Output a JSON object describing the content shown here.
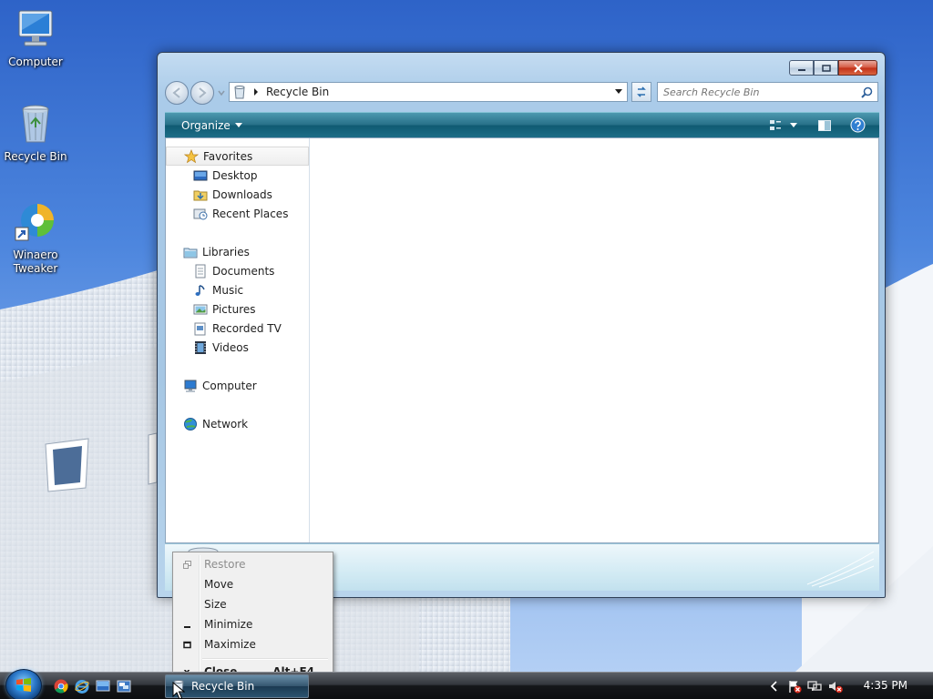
{
  "desktop": {
    "icons": [
      {
        "label": "Computer",
        "icon": "computer-icon"
      },
      {
        "label": "Recycle Bin",
        "icon": "recycle-bin-icon"
      },
      {
        "label": "Winaero Tweaker",
        "icon": "winaero-tweaker-icon"
      }
    ]
  },
  "window": {
    "address": {
      "crumb": "Recycle Bin"
    },
    "search": {
      "placeholder": "Search Recycle Bin"
    },
    "toolbar": {
      "organize_label": "Organize"
    },
    "nav_pane": {
      "favorites": {
        "label": "Favorites",
        "items": [
          "Desktop",
          "Downloads",
          "Recent Places"
        ]
      },
      "libraries": {
        "label": "Libraries",
        "items": [
          "Documents",
          "Music",
          "Pictures",
          "Recorded TV",
          "Videos"
        ]
      },
      "computer": "Computer",
      "network": "Network"
    }
  },
  "context_menu": {
    "items": [
      {
        "label": "Restore",
        "shortcut": "",
        "disabled": true
      },
      {
        "label": "Move",
        "shortcut": ""
      },
      {
        "label": "Size",
        "shortcut": ""
      },
      {
        "label": "Minimize",
        "shortcut": ""
      },
      {
        "label": "Maximize",
        "shortcut": ""
      },
      {
        "label": "Close",
        "shortcut": "Alt+F4",
        "icon_glyph": "x"
      }
    ]
  },
  "taskbar": {
    "active_task": "Recycle Bin",
    "clock": "4:35 PM"
  },
  "colors": {
    "toolbar_teal": "#1d6d87",
    "close_red": "#c12f17",
    "selection_gray": "#eeeeee"
  }
}
